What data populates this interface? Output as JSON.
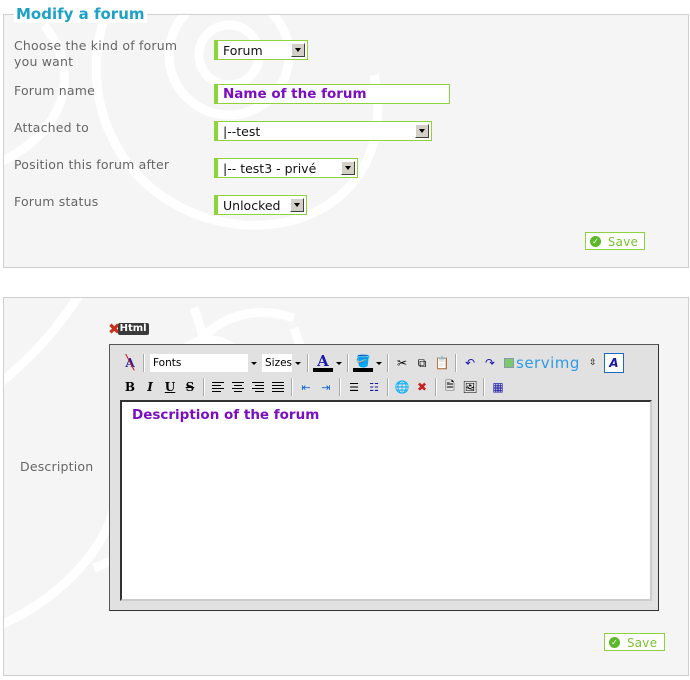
{
  "form1": {
    "title": "Modify a forum",
    "fields": [
      {
        "label": "Choose the kind of forum you want",
        "value": "Forum",
        "type": "select"
      },
      {
        "label": "Forum name",
        "value": "Name of the forum",
        "type": "text"
      },
      {
        "label": "Attached to",
        "value": "|--test",
        "type": "select"
      },
      {
        "label": "Position this forum after",
        "value": "|-- test3 - privé",
        "type": "select"
      },
      {
        "label": "Forum status",
        "value": "Unlocked",
        "type": "select"
      }
    ],
    "save_label": "Save"
  },
  "form2": {
    "description_label": "Description",
    "editor_logo_label": "Html",
    "toolbar": {
      "fonts_value": "Fonts",
      "sizes_value": "Sizes",
      "servimg_label": "servimg"
    },
    "content": "Description of the forum",
    "save_label": "Save"
  },
  "colors": {
    "accent_green": "#8dd43c",
    "title_blue": "#1ea1c8",
    "input_purple": "#7b0fbf"
  }
}
